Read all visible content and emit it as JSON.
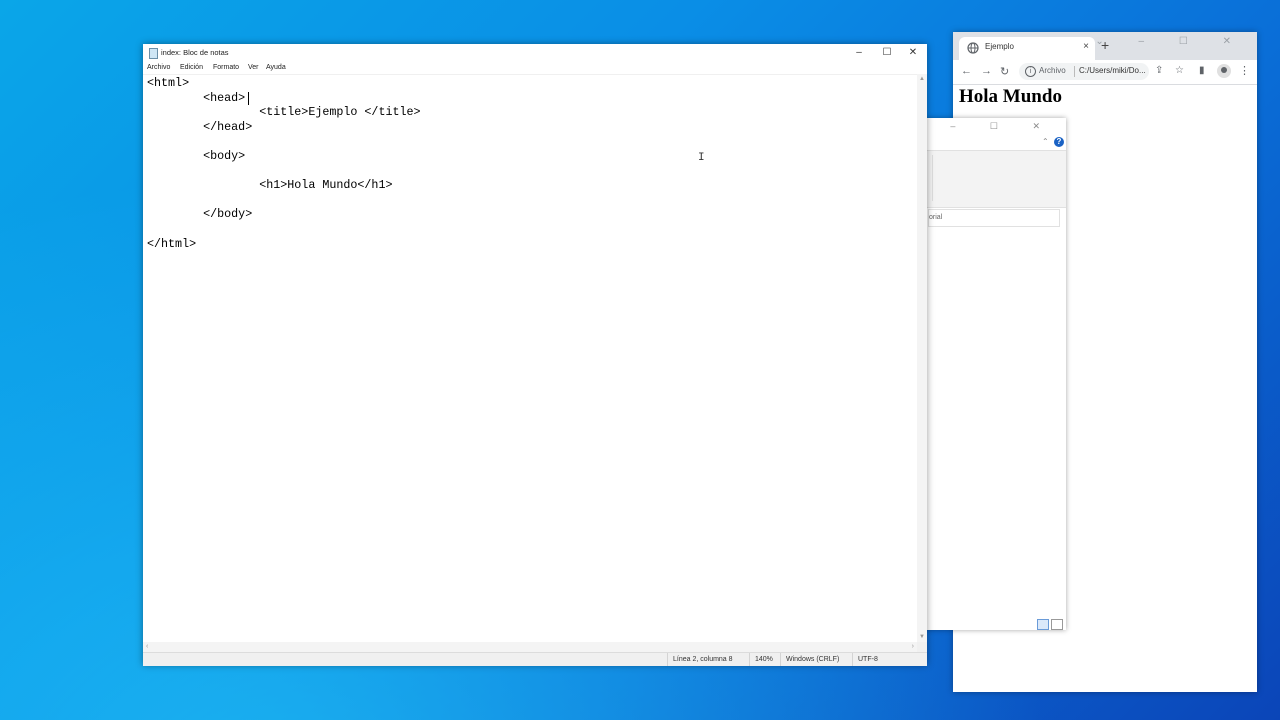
{
  "browser": {
    "tab_title": "Ejemplo",
    "tab_close": "×",
    "new_tab": "+",
    "window_controls": "⌄ – ☐ ✕",
    "nav": {
      "back": "←",
      "forward": "→",
      "reload": "↻"
    },
    "site_chip": "Archivo",
    "url": "C:/Users/miki/Do...",
    "content_h1": "Hola Mundo"
  },
  "behind_window": {
    "controls": "– ☐ ✕",
    "help": "?",
    "caret": "⌃",
    "search_text": "orial"
  },
  "notepad": {
    "title": "index: Bloc de notas",
    "controls": {
      "minimize": "–",
      "maximize": "☐",
      "close": "✕"
    },
    "menu": [
      "Archivo",
      "Edición",
      "Formato",
      "Ver",
      "Ayuda"
    ],
    "code": "<html>\n        <head>\n                <title>Ejemplo </title>\n        </head>\n\n        <body>\n\n                <h1>Hola Mundo</h1>\n\n        </body>\n\n</html>",
    "status": {
      "position": "Línea 2, columna 8",
      "zoom": "140%",
      "line_ending": "Windows (CRLF)",
      "encoding": "UTF-8"
    }
  }
}
